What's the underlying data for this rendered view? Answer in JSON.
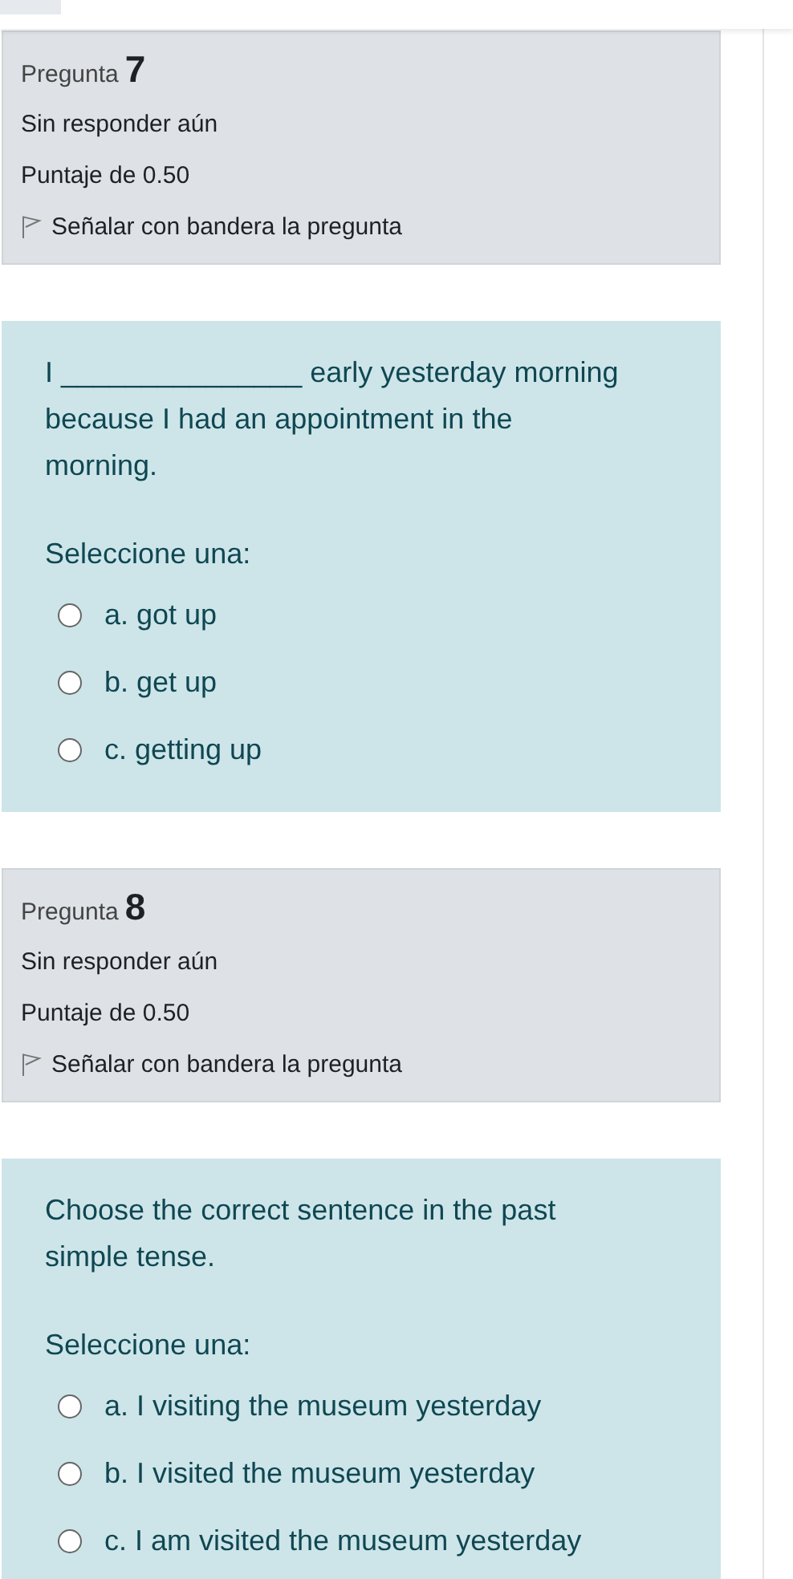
{
  "questions": [
    {
      "info": {
        "label": "Pregunta",
        "number": "7",
        "status": "Sin responder aún",
        "grade": "Puntaje de 0.50",
        "flag": {
          "label": "Señalar con bandera la pregunta",
          "flagged": false
        }
      },
      "text": "I _______________ early yesterday morning because I had an appointment in the morning.",
      "prompt": "Seleccione una:",
      "options": [
        {
          "label": "a. got up",
          "selected": false
        },
        {
          "label": "b. get up",
          "selected": false
        },
        {
          "label": "c. getting up",
          "selected": false
        }
      ]
    },
    {
      "info": {
        "label": "Pregunta",
        "number": "8",
        "status": "Sin responder aún",
        "grade": "Puntaje de 0.50",
        "flag": {
          "label": "Señalar con bandera la pregunta",
          "flagged": false
        }
      },
      "text": "Choose the correct sentence in the past simple tense.",
      "prompt": "Seleccione una:",
      "options": [
        {
          "label": "a. I visiting the museum yesterday",
          "selected": false
        },
        {
          "label": "b. I visited the museum yesterday",
          "selected": false
        },
        {
          "label": "c. I am visited the museum yesterday",
          "selected": false
        }
      ]
    }
  ]
}
